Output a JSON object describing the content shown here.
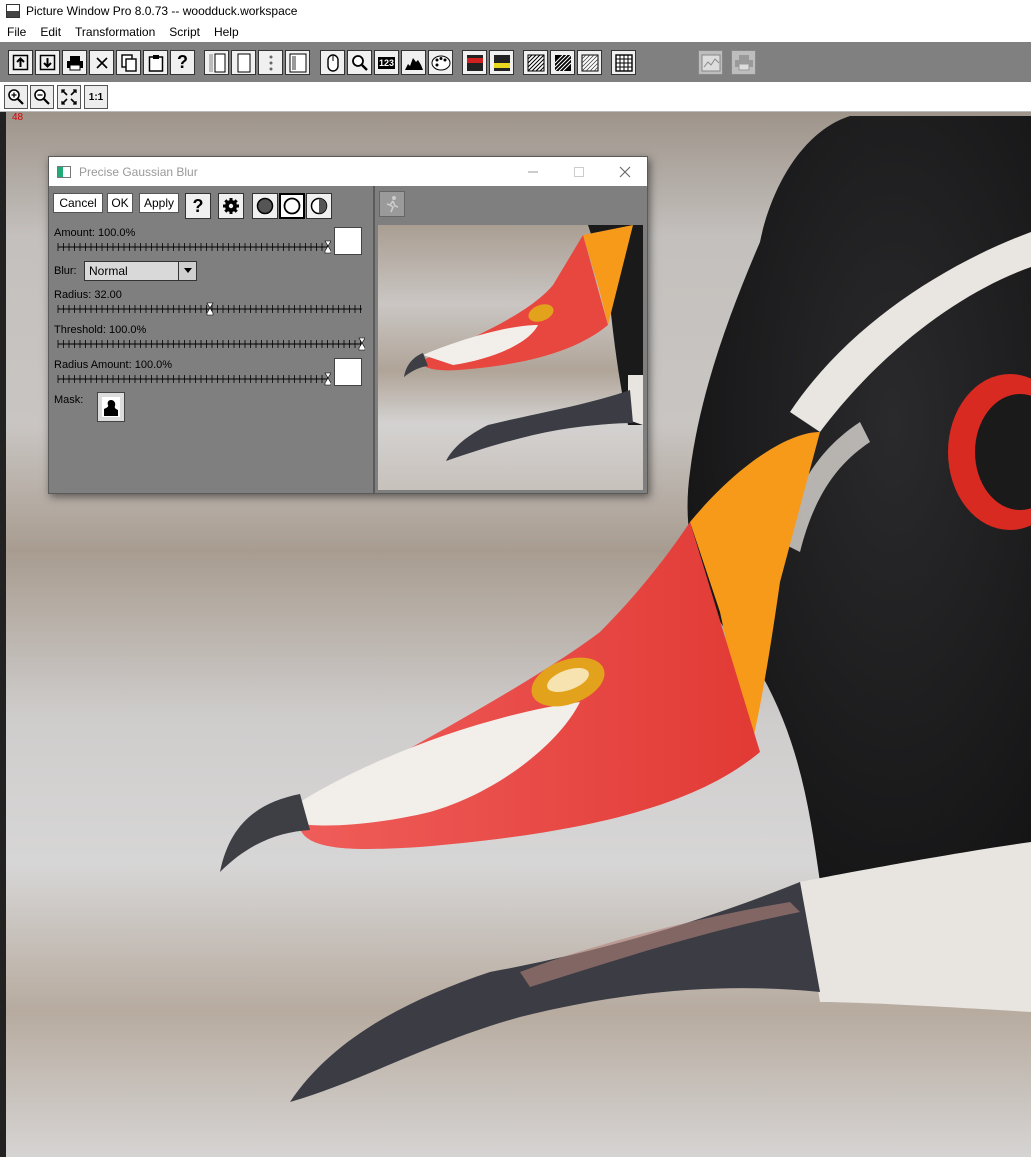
{
  "app": {
    "title": "Picture Window Pro 8.0.73  --  woodduck.workspace",
    "menu": [
      "File",
      "Edit",
      "Transformation",
      "Script",
      "Help"
    ]
  },
  "toolbar": {
    "icons": [
      "open-workspace-icon",
      "save-icon",
      "print-icon",
      "close-icon",
      "copy-icon",
      "paste-icon",
      "help-icon",
      "layout-dual-icon",
      "layout-single-icon",
      "layout-dots-icon",
      "layout-panel-icon",
      "mouse-icon",
      "magnifier-icon",
      "numbers-icon",
      "histogram-icon",
      "palette-icon",
      "color-red-icon",
      "color-yellow-icon",
      "pattern-icon",
      "pattern-inverse-icon",
      "pattern-light-icon",
      "grid-icon",
      "chart-icon",
      "printer-icon"
    ],
    "numbers_label": "123"
  },
  "zoom_toolbar": {
    "zoom_in": "zoom-in-icon",
    "zoom_out": "zoom-out-icon",
    "fit": "fit-icon",
    "actual_label": "1:1"
  },
  "workspace": {
    "frame_number": "48"
  },
  "dialog": {
    "title": "Precise Gaussian Blur",
    "buttons": {
      "cancel": "Cancel",
      "ok": "OK",
      "apply": "Apply",
      "help": "?"
    },
    "controls": {
      "amount_label": "Amount: 100.0%",
      "amount_value": 1.0,
      "blur_label": "Blur:",
      "blur_value": "Normal",
      "radius_label": "Radius: 32.00",
      "radius_fraction": 0.5,
      "threshold_label": "Threshold: 100.0%",
      "threshold_value": 1.0,
      "radius_amount_label": "Radius Amount: 100.0%",
      "radius_amount_value": 1.0,
      "mask_label": "Mask:"
    }
  },
  "colors": {
    "toolbar_bg": "#808080",
    "dialog_bg": "#7f7f7f",
    "bill_red": "#e8473f",
    "bill_orange": "#f79a1a",
    "feather_black": "#1b1b1d",
    "eye_red": "#d82a20"
  }
}
